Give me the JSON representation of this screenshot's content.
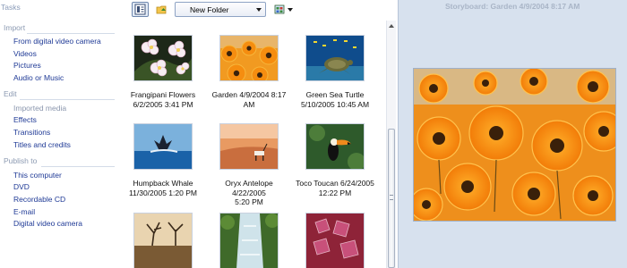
{
  "tasks": {
    "title": "Tasks",
    "import": {
      "heading": "Import",
      "items": [
        "From digital video camera",
        "Videos",
        "Pictures",
        "Audio or Music"
      ]
    },
    "edit": {
      "heading": "Edit",
      "items": [
        "Imported media",
        "Effects",
        "Transitions",
        "Titles and credits"
      ]
    },
    "publish": {
      "heading": "Publish to",
      "items": [
        "This computer",
        "DVD",
        "Recordable CD",
        "E-mail",
        "Digital video camera"
      ]
    }
  },
  "toolbar": {
    "folder_select": "New Folder",
    "icons": [
      "view-mode-icon",
      "folder-up-icon",
      "view-type-icon"
    ]
  },
  "media_items": [
    {
      "line1": "Frangipani Flowers",
      "line2": "6/2/2005 3:41 PM",
      "icon": "frangipani-flowers-thumbnail"
    },
    {
      "line1": "Garden 4/9/2004 8:17",
      "line2": "AM",
      "icon": "garden-thumbnail"
    },
    {
      "line1": "Green Sea Turtle",
      "line2": "5/10/2005 10:45 AM",
      "icon": "green-sea-turtle-thumbnail"
    },
    {
      "line1": "Humpback Whale",
      "line2": "11/30/2005 1:20 PM",
      "icon": "humpback-whale-thumbnail"
    },
    {
      "line1": "Oryx Antelope 4/22/2005",
      "line2": "5:20 PM",
      "icon": "oryx-antelope-thumbnail"
    },
    {
      "line1": "Toco Toucan 6/24/2005",
      "line2": "12:22 PM",
      "icon": "toco-toucan-thumbnail"
    },
    {
      "line1": "",
      "line2": "",
      "icon": "tree-thumbnail"
    },
    {
      "line1": "",
      "line2": "",
      "icon": "waterfall-thumbnail"
    },
    {
      "line1": "",
      "line2": "",
      "icon": "autumn-leaves-thumbnail"
    }
  ],
  "preview": {
    "title": "Storyboard: Garden 4/9/2004 8:17 AM",
    "image_icon": "garden-preview-image"
  },
  "colors": {
    "link": "#1f3a96",
    "heading": "#8c9ab2",
    "preview_bg": "#d7e1ee",
    "selected_border": "#6d86ad"
  }
}
